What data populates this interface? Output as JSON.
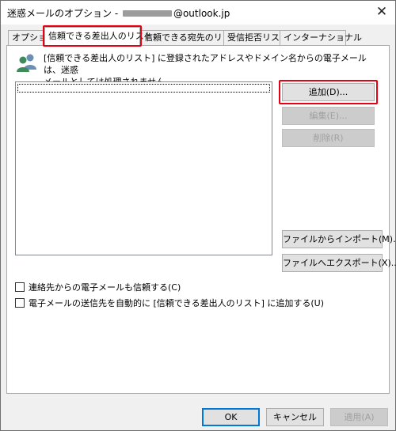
{
  "window": {
    "title_prefix": "迷惑メールのオプション - ",
    "title_suffix": "@outlook.jp",
    "close_label": "✕"
  },
  "tabs": [
    {
      "label": "オプション",
      "active": false
    },
    {
      "label": "信頼できる差出人のリスト",
      "active": true
    },
    {
      "label": "信頼できる宛先のリスト",
      "active": false
    },
    {
      "label": "受信拒否リスト",
      "active": false
    },
    {
      "label": "インターナショナル",
      "active": false
    }
  ],
  "panel": {
    "description_line1": "[信頼できる差出人のリスト] に登録されたアドレスやドメイン名からの電子メールは、迷惑",
    "description_line2": "メールとしては処理されません。",
    "buttons": {
      "add": "追加(D)...",
      "edit": "編集(E)...",
      "delete": "削除(R)",
      "import": "ファイルからインポート(M)...",
      "export": "ファイルへエクスポート(X)..."
    },
    "checkboxes": [
      {
        "label": "連絡先からの電子メールも信頼する(C)",
        "checked": false
      },
      {
        "label": "電子メールの送信先を自動的に [信頼できる差出人のリスト] に追加する(U)",
        "checked": false
      }
    ]
  },
  "footer": {
    "ok": "OK",
    "cancel": "キャンセル",
    "apply": "適用(A)"
  },
  "colors": {
    "highlight": "#e60012",
    "default_button_border": "#0078d7"
  },
  "icons": {
    "info": "people-icon",
    "close": "close-icon"
  }
}
